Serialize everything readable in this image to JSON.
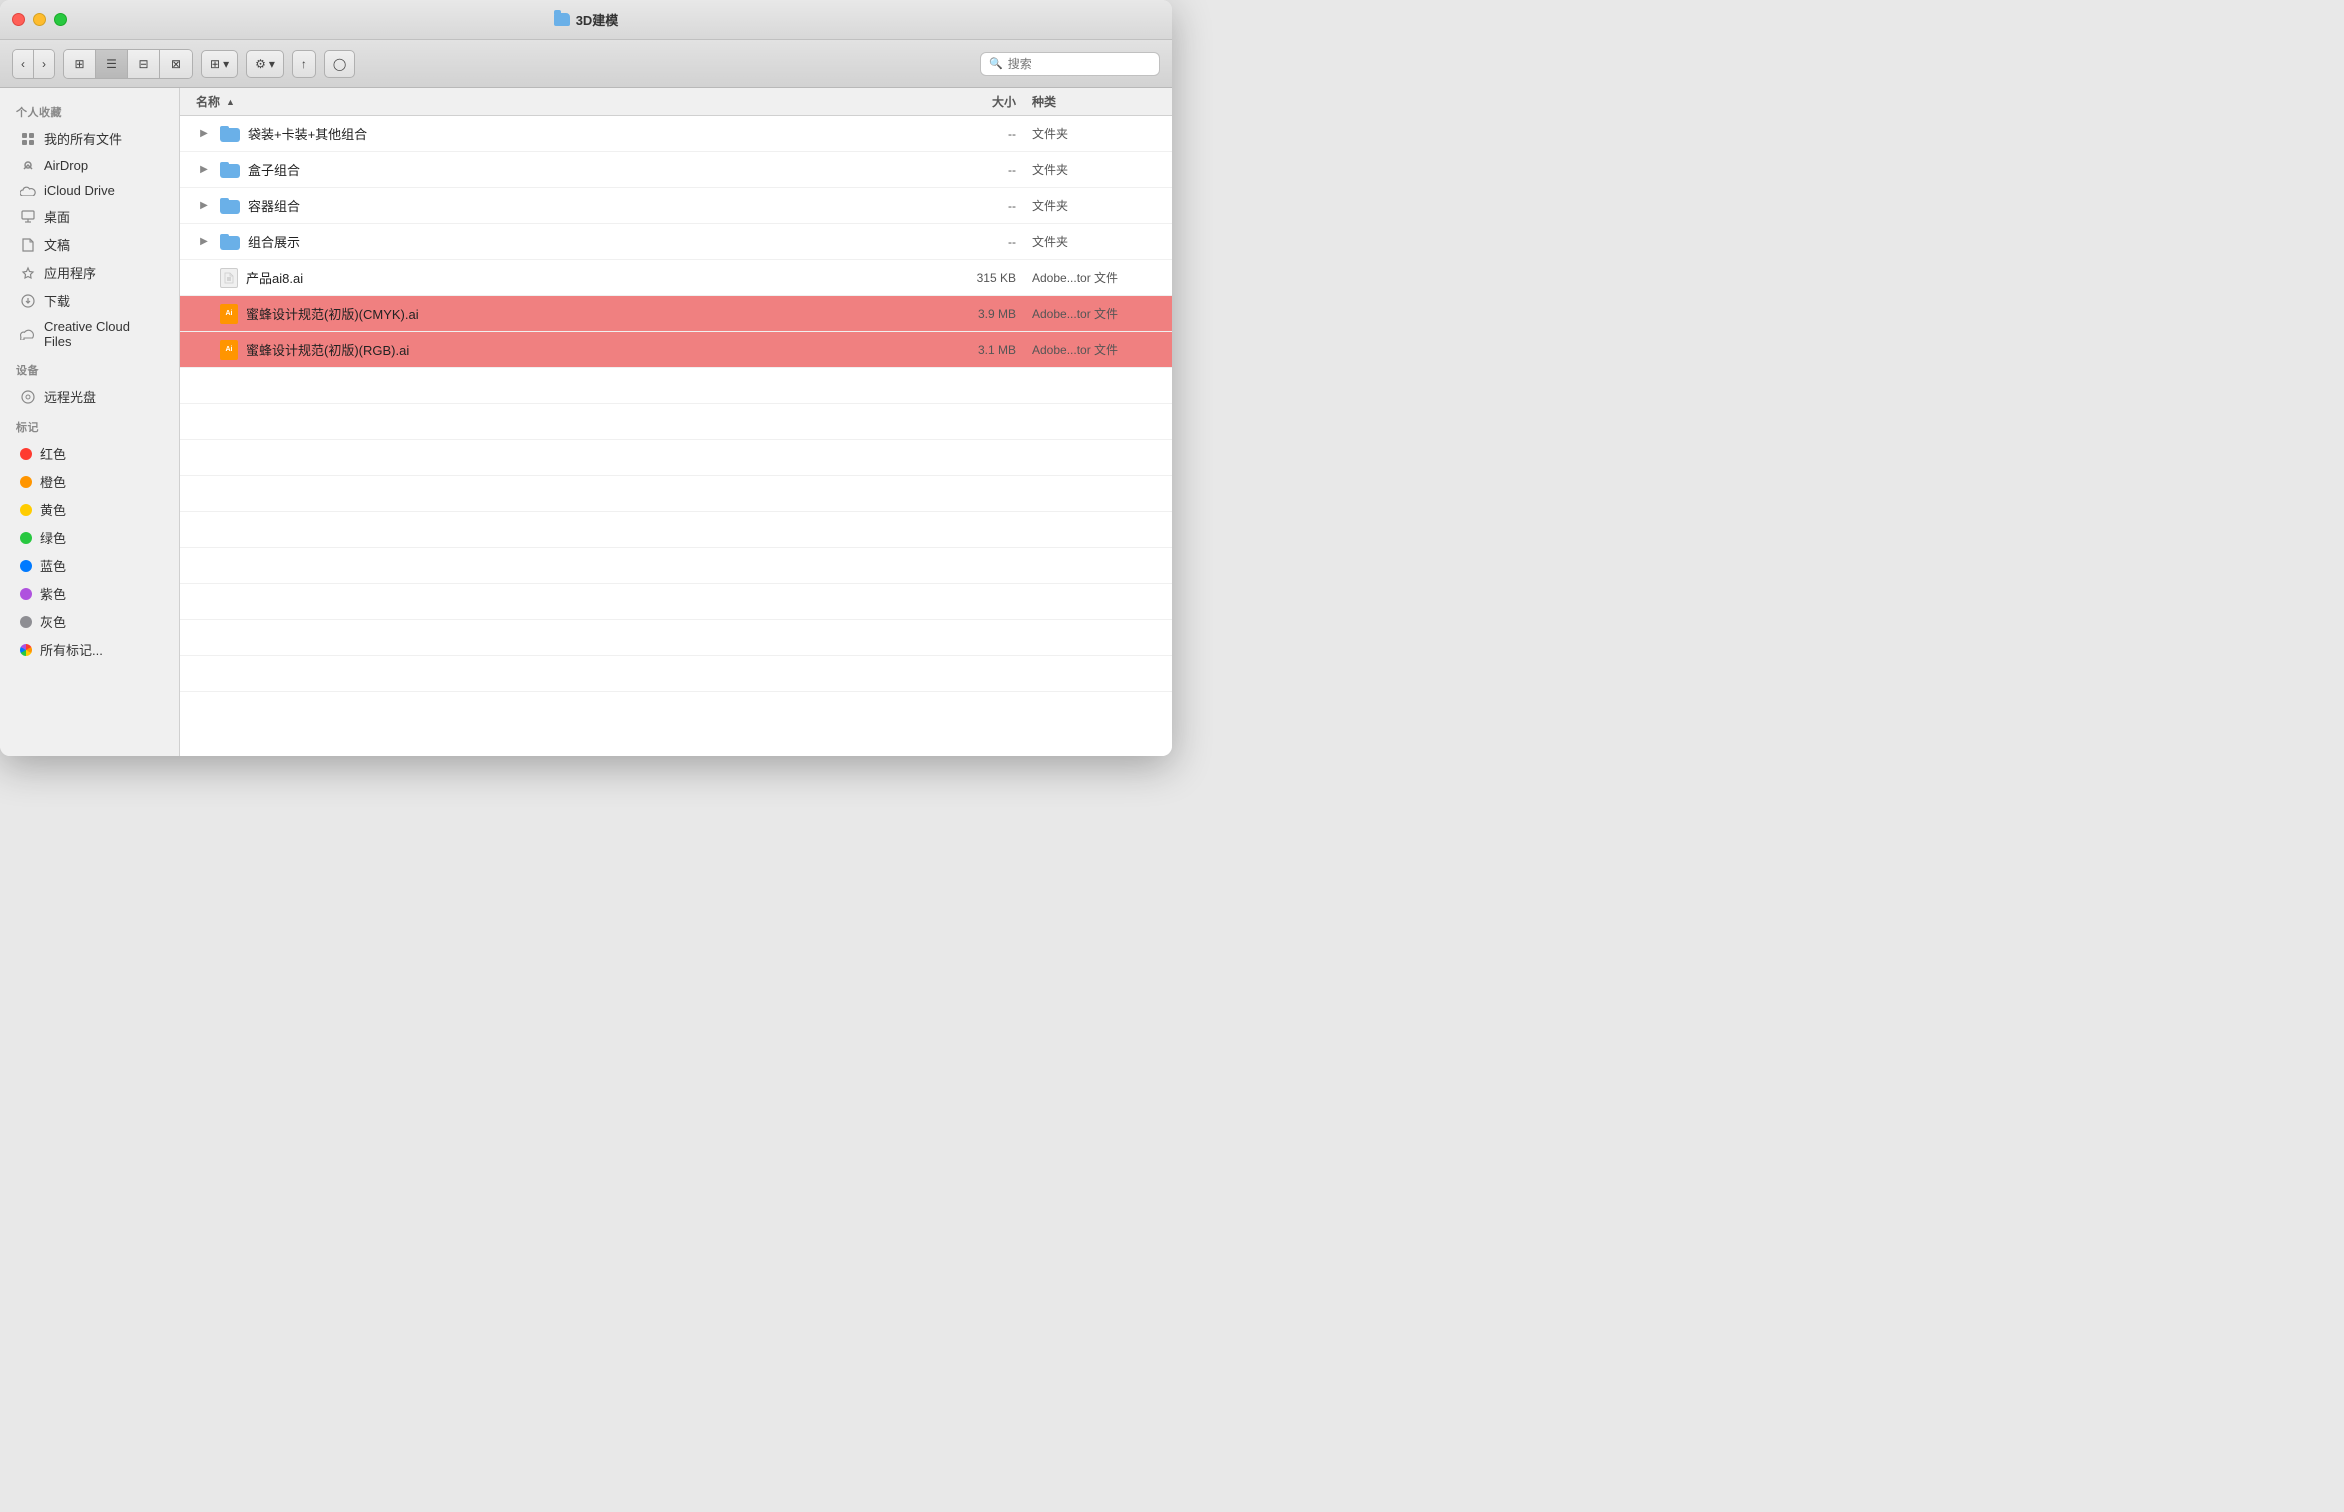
{
  "window": {
    "title": "3D建模"
  },
  "toolbar": {
    "search_placeholder": "搜索",
    "view_icons": [
      "⊞",
      "☰",
      "⊟",
      "⊠"
    ],
    "active_view": 1
  },
  "sidebar": {
    "favorites_label": "个人收藏",
    "devices_label": "设备",
    "tags_label": "标记",
    "items": [
      {
        "id": "my-files",
        "label": "我的所有文件",
        "icon": "grid"
      },
      {
        "id": "airdrop",
        "label": "AirDrop",
        "icon": "airdrop"
      },
      {
        "id": "icloud",
        "label": "iCloud Drive",
        "icon": "icloud"
      },
      {
        "id": "desktop",
        "label": "桌面",
        "icon": "desktop"
      },
      {
        "id": "documents",
        "label": "文稿",
        "icon": "document"
      },
      {
        "id": "applications",
        "label": "应用程序",
        "icon": "apps"
      },
      {
        "id": "downloads",
        "label": "下载",
        "icon": "download"
      },
      {
        "id": "creative-cloud",
        "label": "Creative Cloud Files",
        "icon": "cc"
      }
    ],
    "devices": [
      {
        "id": "remote-disc",
        "label": "远程光盘",
        "icon": "disc"
      }
    ],
    "tags": [
      {
        "id": "red",
        "label": "红色",
        "color": "#ff3b30"
      },
      {
        "id": "orange",
        "label": "橙色",
        "color": "#ff9500"
      },
      {
        "id": "yellow",
        "label": "黄色",
        "color": "#ffcc00"
      },
      {
        "id": "green",
        "label": "绿色",
        "color": "#28c840"
      },
      {
        "id": "blue",
        "label": "蓝色",
        "color": "#007aff"
      },
      {
        "id": "purple",
        "label": "紫色",
        "color": "#af52de"
      },
      {
        "id": "gray",
        "label": "灰色",
        "color": "#8e8e93"
      },
      {
        "id": "all-tags",
        "label": "所有标记...",
        "color": null
      }
    ]
  },
  "file_list": {
    "columns": {
      "name": "名称",
      "size": "大小",
      "kind": "种类"
    },
    "sort_arrow": "▲",
    "files": [
      {
        "id": "folder1",
        "name": "袋装+卡装+其他组合",
        "type": "folder",
        "size": "--",
        "kind": "文件夹",
        "selected": false
      },
      {
        "id": "folder2",
        "name": "盒子组合",
        "type": "folder",
        "size": "--",
        "kind": "文件夹",
        "selected": false
      },
      {
        "id": "folder3",
        "name": "容器组合",
        "type": "folder",
        "size": "--",
        "kind": "文件夹",
        "selected": false
      },
      {
        "id": "folder4",
        "name": "组合展示",
        "type": "folder",
        "size": "--",
        "kind": "文件夹",
        "selected": false
      },
      {
        "id": "file1",
        "name": "产品ai8.ai",
        "type": "doc",
        "size": "315 KB",
        "kind": "Adobe...tor 文件",
        "selected": false
      },
      {
        "id": "file2",
        "name": "蜜蜂设计规范(初版)(CMYK).ai",
        "type": "ai",
        "size": "3.9 MB",
        "kind": "Adobe...tor 文件",
        "selected": true
      },
      {
        "id": "file3",
        "name": "蜜蜂设计规范(初版)(RGB).ai",
        "type": "ai",
        "size": "3.1 MB",
        "kind": "Adobe...tor 文件",
        "selected": true
      }
    ]
  }
}
